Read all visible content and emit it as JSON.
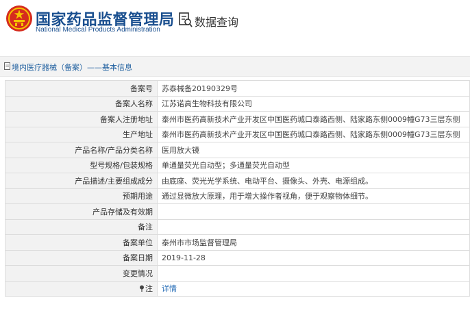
{
  "header": {
    "title_cn": "国家药品监督管理局",
    "title_en": "National Medical Products Administration",
    "query_label": "数据查询"
  },
  "breadcrumb": "境内医疗器械（备案）——基本信息",
  "rows": [
    {
      "label": "备案号",
      "value": "苏泰械备20190329号"
    },
    {
      "label": "备案人名称",
      "value": "江苏诺高生物科技有限公司"
    },
    {
      "label": "备案人注册地址",
      "value": "泰州市医药高新技术产业开发区中国医药城口泰路西侧、陆家路东侧0009幢G73三层东侧"
    },
    {
      "label": "生产地址",
      "value": "泰州市医药高新技术产业开发区中国医药城口泰路西侧、陆家路东侧0009幢G73三层东侧"
    },
    {
      "label": "产品名称/产品分类名称",
      "value": "医用放大镜"
    },
    {
      "label": "型号规格/包装规格",
      "value": "单通量荧光自动型；多通量荧光自动型"
    },
    {
      "label": "产品描述/主要组成成分",
      "value": "由底座、荧光光学系统、电动平台、摄像头、外壳、电源组成。"
    },
    {
      "label": "预期用途",
      "value": "通过显微放大原理，用于增大操作者视角，便于观察物体细节。"
    },
    {
      "label": "产品存储及有效期",
      "value": ""
    },
    {
      "label": "备注",
      "value": ""
    },
    {
      "label": "备案单位",
      "value": "泰州市市场监督管理局"
    },
    {
      "label": "备案日期",
      "value": "2019-11-28"
    },
    {
      "label": "变更情况",
      "value": ""
    },
    {
      "label": "注",
      "value": "详情"
    }
  ],
  "icons": {
    "emblem": "national-emblem-icon",
    "query": "data-query-icon",
    "breadcrumb": "document-icon",
    "note": "pin-icon"
  },
  "colors": {
    "brand_blue": "#1a4f8f",
    "link_blue": "#2a6fb8",
    "label_bg": "#f2f2f2",
    "border": "#dcdcdc"
  }
}
